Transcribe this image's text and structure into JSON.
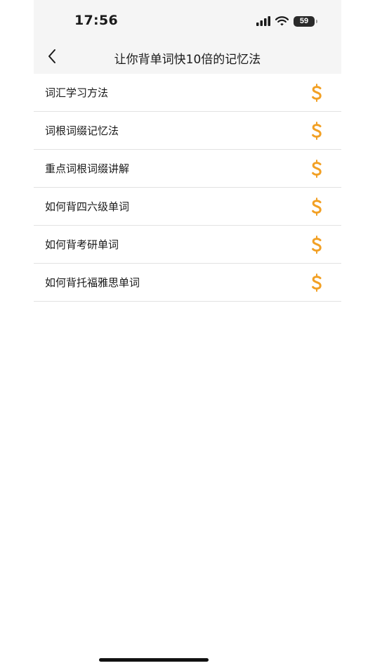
{
  "status_bar": {
    "time": "17:56",
    "battery_level": "59",
    "icons": [
      "signal-icon",
      "wifi-icon",
      "battery-icon"
    ]
  },
  "nav": {
    "back_icon": "chevron-left-icon",
    "title": "让你背单词快10倍的记忆法"
  },
  "list": {
    "items": [
      {
        "label": "词汇学习方法",
        "icon": "dollar-icon"
      },
      {
        "label": "词根词缀记忆法",
        "icon": "dollar-icon"
      },
      {
        "label": "重点词根词缀讲解",
        "icon": "dollar-icon"
      },
      {
        "label": "如何背四六级单词",
        "icon": "dollar-icon"
      },
      {
        "label": "如何背考研单词",
        "icon": "dollar-icon"
      },
      {
        "label": "如何背托福雅思单词",
        "icon": "dollar-icon"
      }
    ]
  },
  "colors": {
    "accent": "#F2A024",
    "header_bg": "#F5F5F5",
    "divider": "#E2E2E2",
    "text": "#1A1A1A"
  }
}
